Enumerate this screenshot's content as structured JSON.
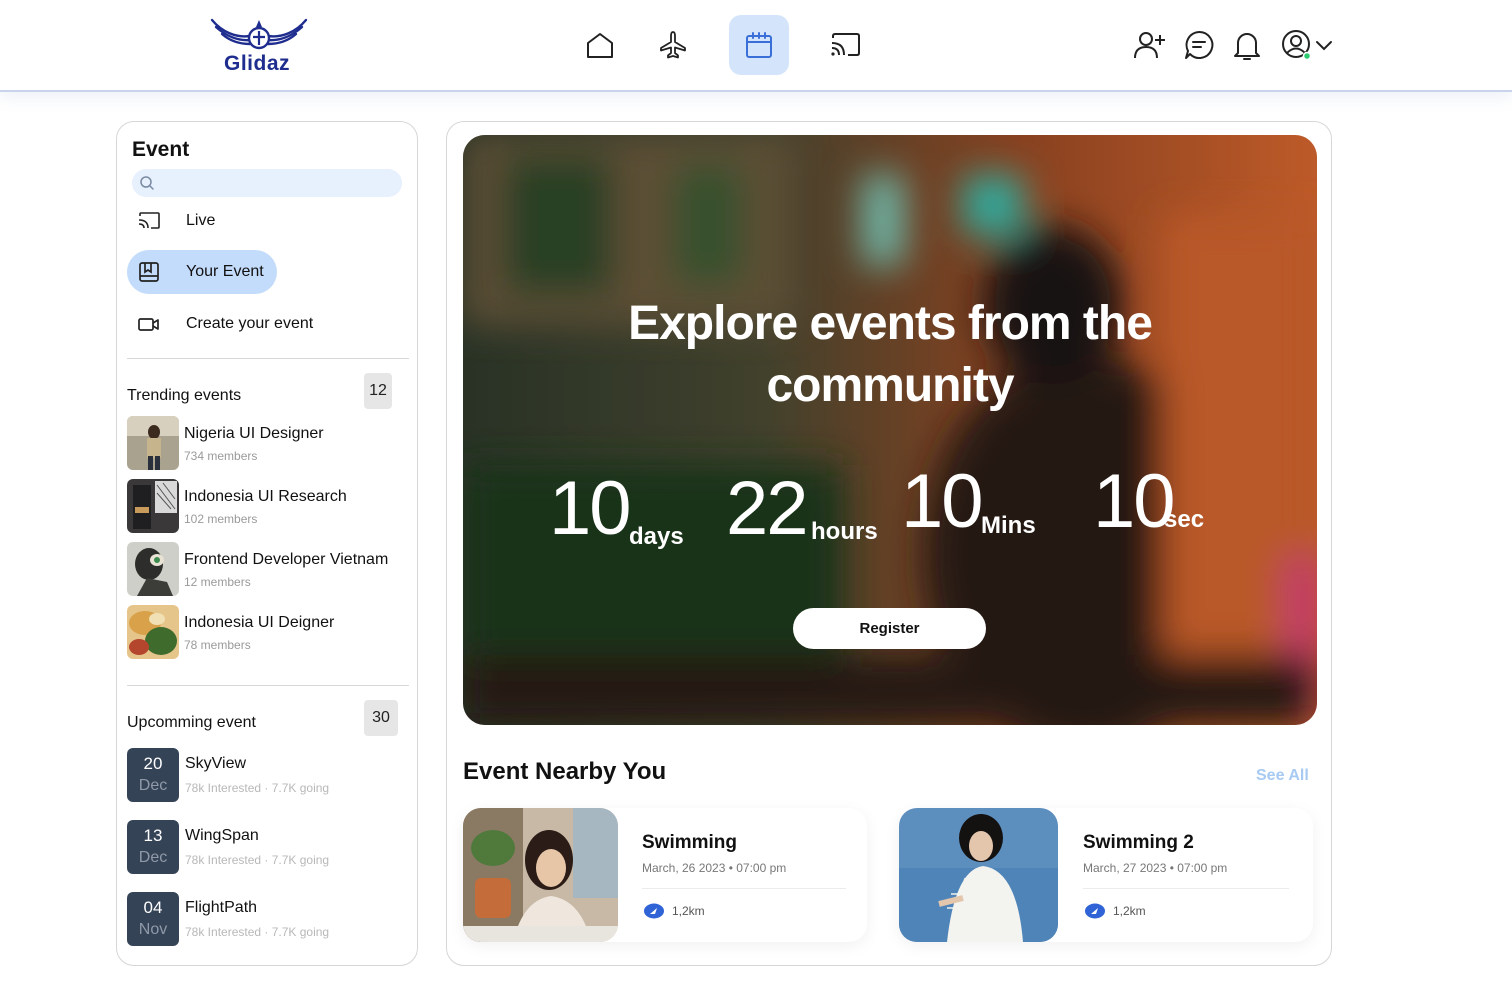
{
  "app": {
    "brand": "Glidaz"
  },
  "nav": {
    "items": [
      {
        "name": "home",
        "icon": "home-icon"
      },
      {
        "name": "flights",
        "icon": "airplane-icon"
      },
      {
        "name": "events",
        "icon": "calendar-icon",
        "active": true
      },
      {
        "name": "cast",
        "icon": "cast-icon"
      }
    ],
    "right_icons": [
      "add-user-icon",
      "chat-icon",
      "bell-icon",
      "profile-icon",
      "chevron-down-icon"
    ]
  },
  "sidebar": {
    "title": "Event",
    "search_placeholder": "",
    "menu": [
      {
        "label": "Live",
        "icon": "cast-icon"
      },
      {
        "label": "Your Event",
        "icon": "bookmark-book-icon",
        "active": true
      },
      {
        "label": "Create your event",
        "icon": "video-camera-icon"
      }
    ],
    "trending": {
      "title": "Trending events",
      "count": "12",
      "items": [
        {
          "name": "Nigeria UI Designer",
          "members": "734 members"
        },
        {
          "name": "Indonesia UI Research",
          "members": "102 members"
        },
        {
          "name": "Frontend Developer Vietnam",
          "members": "12 members"
        },
        {
          "name": "Indonesia UI Deigner",
          "members": "78 members"
        }
      ]
    },
    "upcoming": {
      "title": "Upcomming event",
      "count": "30",
      "items": [
        {
          "day": "20",
          "month": "Dec",
          "name": "SkyView",
          "meta": "78k Interested · 7.7K going"
        },
        {
          "day": "13",
          "month": "Dec",
          "name": "WingSpan",
          "meta": "78k Interested · 7.7K going"
        },
        {
          "day": "04",
          "month": "Nov",
          "name": "FlightPath",
          "meta": "78k Interested · 7.7K going"
        }
      ]
    }
  },
  "hero": {
    "title_line1": "Explore events from the",
    "title_line2": "community",
    "countdown": {
      "days": "10",
      "days_label": "days",
      "hours": "22",
      "hours_label": "hours",
      "mins": "10",
      "mins_label": "Mins",
      "secs": "10",
      "secs_label": "sec"
    },
    "register_label": "Register"
  },
  "nearby": {
    "title": "Event Nearby You",
    "see_all": "See All",
    "cards": [
      {
        "title": "Swimming",
        "date": "March, 26 2023 • 07:00 pm",
        "distance": "1,2km"
      },
      {
        "title": "Swimming 2",
        "date": "March, 27 2023 • 07:00 pm",
        "distance": "1,2km"
      }
    ]
  },
  "colors": {
    "accent": "#d4e5fb",
    "brand": "#1f2d8f",
    "active_menu": "#c4dcfb",
    "date_tile": "#354357",
    "see_all": "#a7caf3"
  }
}
